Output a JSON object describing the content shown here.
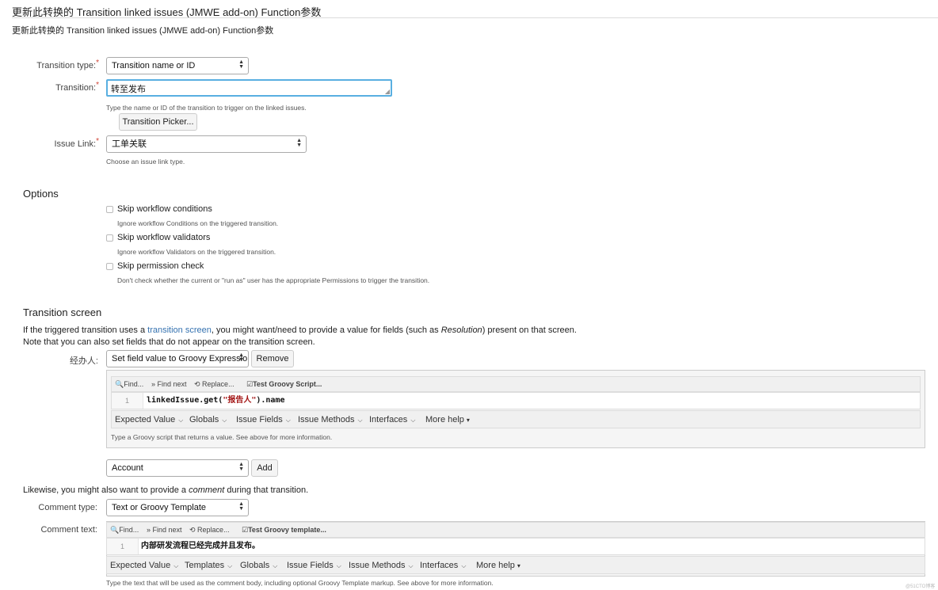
{
  "header": {
    "title": "更新此转换的 Transition linked issues (JMWE add-on) Function参数",
    "subtitle": "更新此转换的 Transition linked issues (JMWE add-on) Function参数"
  },
  "form": {
    "transition_type": {
      "label": "Transition type:",
      "value": "Transition name or ID"
    },
    "transition": {
      "label": "Transition:",
      "value": "转至发布",
      "help": "Type the name or ID of the transition to trigger on the linked issues."
    },
    "picker_button": "Transition Picker...",
    "issue_link": {
      "label": "Issue Link:",
      "value": "工单关联",
      "help": "Choose an issue link type."
    },
    "required_mark": "*"
  },
  "options": {
    "heading": "Options",
    "items": [
      {
        "label": "Skip workflow conditions",
        "help": "Ignore workflow Conditions on the triggered transition.",
        "checked": false
      },
      {
        "label": "Skip workflow validators",
        "help": "Ignore workflow Validators on the triggered transition.",
        "checked": false
      },
      {
        "label": "Skip permission check",
        "help": "Don't check whether the current or \"run as\" user has the appropriate Permissions to trigger the transition.",
        "checked": false
      }
    ]
  },
  "transition_screen": {
    "heading": "Transition screen",
    "para1_a": "If the triggered transition uses a ",
    "para1_link": "transition screen",
    "para1_b": ", you might want/need to provide a value for fields (such as ",
    "para1_em": "Resolution",
    "para1_c": ") present on that screen.",
    "para2": "Note that you can also set fields that do not appear on the transition screen.",
    "field_label": "经办人:",
    "field_mode": "Set field value to Groovy Expression",
    "remove_button": "Remove",
    "editor": {
      "toolbar": {
        "find": "Find...",
        "find_next": "Find next",
        "replace": "Replace...",
        "test": "Test Groovy Script..."
      },
      "line_number": "1",
      "code_a": "linkedIssue.get(",
      "code_str": "\"报告人\"",
      "code_b": ").name",
      "menus": [
        "Expected Value",
        "Globals",
        "Issue Fields",
        "Issue Methods",
        "Interfaces",
        "More help"
      ],
      "help": "Type a Groovy script that returns a value. See above for more information."
    },
    "add_field_value": "Account",
    "add_button": "Add"
  },
  "comment": {
    "para_a": "Likewise, you might also want to provide a ",
    "para_em": "comment",
    "para_b": " during that transition.",
    "type_label": "Comment type:",
    "type_value": "Text or Groovy Template",
    "text_label": "Comment text:",
    "editor": {
      "toolbar": {
        "find": "Find...",
        "find_next": "Find next",
        "replace": "Replace...",
        "test": "Test Groovy template..."
      },
      "line_number": "1",
      "code": "内部研发流程已经完成并且发布。",
      "menus": [
        "Expected Value",
        "Templates",
        "Globals",
        "Issue Fields",
        "Issue Methods",
        "Interfaces",
        "More help"
      ]
    },
    "help": "Type the text that will be used as the comment body, including optional Groovy Template markup. See above for more information."
  },
  "watermark": "@51CTO博客",
  "colors": {
    "link": "#3572b0",
    "focus_border": "#59afe1",
    "required": "#d04437"
  }
}
